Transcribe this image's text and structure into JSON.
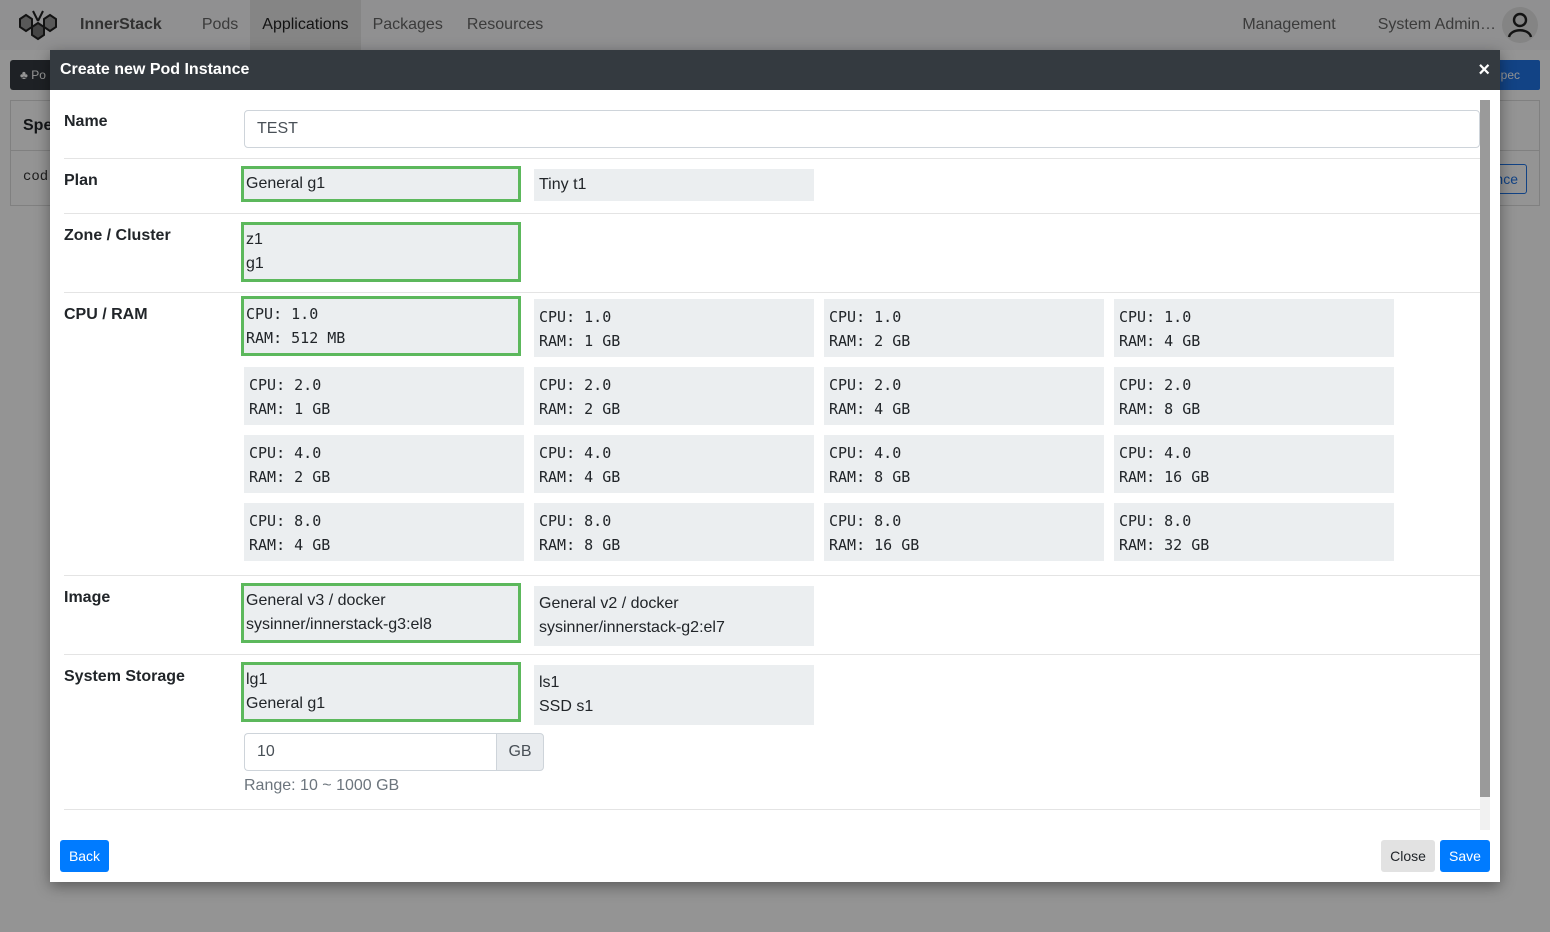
{
  "navbar": {
    "brand": "InnerStack",
    "items": [
      {
        "label": "Pods",
        "active": false
      },
      {
        "label": "Applications",
        "active": true
      },
      {
        "label": "Packages",
        "active": false
      },
      {
        "label": "Resources",
        "active": false
      }
    ],
    "right_items": [
      {
        "label": "Management"
      },
      {
        "label": "System Admin…"
      }
    ]
  },
  "background": {
    "toolbar_button": "Po",
    "right_button": "oSpec",
    "card_header": "Spe",
    "card_body": "cod",
    "card_button": "nce"
  },
  "modal": {
    "title": "Create new Pod Instance",
    "close_icon": "×",
    "fields": {
      "name": {
        "label": "Name",
        "value": "TEST"
      },
      "plan": {
        "label": "Plan",
        "options": [
          {
            "lines": [
              "General g1"
            ],
            "selected": true
          },
          {
            "lines": [
              "Tiny t1"
            ],
            "selected": false
          }
        ]
      },
      "zone": {
        "label": "Zone / Cluster",
        "options": [
          {
            "lines": [
              "z1",
              "g1"
            ],
            "selected": true
          }
        ]
      },
      "cpu_ram": {
        "label": "CPU / RAM",
        "options": [
          {
            "lines": [
              "CPU: 1.0",
              "RAM: 512 MB"
            ],
            "selected": true
          },
          {
            "lines": [
              "CPU: 1.0",
              "RAM: 1 GB"
            ],
            "selected": false
          },
          {
            "lines": [
              "CPU: 1.0",
              "RAM: 2 GB"
            ],
            "selected": false
          },
          {
            "lines": [
              "CPU: 1.0",
              "RAM: 4 GB"
            ],
            "selected": false
          },
          {
            "lines": [
              "CPU: 2.0",
              "RAM: 1 GB"
            ],
            "selected": false
          },
          {
            "lines": [
              "CPU: 2.0",
              "RAM: 2 GB"
            ],
            "selected": false
          },
          {
            "lines": [
              "CPU: 2.0",
              "RAM: 4 GB"
            ],
            "selected": false
          },
          {
            "lines": [
              "CPU: 2.0",
              "RAM: 8 GB"
            ],
            "selected": false
          },
          {
            "lines": [
              "CPU: 4.0",
              "RAM: 2 GB"
            ],
            "selected": false
          },
          {
            "lines": [
              "CPU: 4.0",
              "RAM: 4 GB"
            ],
            "selected": false
          },
          {
            "lines": [
              "CPU: 4.0",
              "RAM: 8 GB"
            ],
            "selected": false
          },
          {
            "lines": [
              "CPU: 4.0",
              "RAM: 16 GB"
            ],
            "selected": false
          },
          {
            "lines": [
              "CPU: 8.0",
              "RAM: 4 GB"
            ],
            "selected": false
          },
          {
            "lines": [
              "CPU: 8.0",
              "RAM: 8 GB"
            ],
            "selected": false
          },
          {
            "lines": [
              "CPU: 8.0",
              "RAM: 16 GB"
            ],
            "selected": false
          },
          {
            "lines": [
              "CPU: 8.0",
              "RAM: 32 GB"
            ],
            "selected": false
          }
        ]
      },
      "image": {
        "label": "Image",
        "options": [
          {
            "lines": [
              "General v3 / docker",
              "sysinner/innerstack-g3:el8"
            ],
            "selected": true
          },
          {
            "lines": [
              "General v2 / docker",
              "sysinner/innerstack-g2:el7"
            ],
            "selected": false
          }
        ]
      },
      "system_storage": {
        "label": "System Storage",
        "options": [
          {
            "lines": [
              "lg1",
              "General g1"
            ],
            "selected": true
          },
          {
            "lines": [
              "ls1",
              "SSD s1"
            ],
            "selected": false
          }
        ],
        "size_value": "10",
        "size_unit": "GB",
        "range_text": "Range: 10 ~ 1000 GB"
      }
    },
    "footer": {
      "back_label": "Back",
      "close_label": "Close",
      "save_label": "Save"
    }
  },
  "colors": {
    "selected_border": "#5cb85c",
    "primary": "#007bff",
    "header_bg": "#343a40",
    "option_bg": "#ebeef0"
  }
}
